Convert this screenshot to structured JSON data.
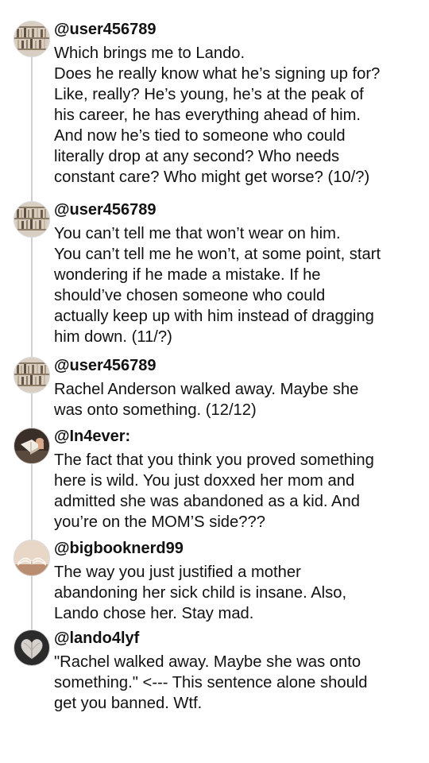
{
  "colors": {
    "text": "#111111",
    "thread_line": "#cfcfcf",
    "background": "#ffffff"
  },
  "posts": [
    {
      "handle": "@user456789",
      "avatar": "bookshelf-avatar",
      "lines": [
        "Which brings me to Lando.",
        "Does he really know what he’s signing up for?",
        "Like, really? He’s young, he’s at the peak of",
        "his career, he has everything ahead of him.",
        "And now he’s tied to someone who could",
        "literally drop at any second? Who needs",
        "constant care? Who might get worse? (10/?)"
      ]
    },
    {
      "handle": "@user456789",
      "avatar": "bookshelf-avatar",
      "lines": [
        "You can’t tell me that won’t wear on him.",
        "You can’t tell me he won’t, at some point, start",
        "wondering if he made a mistake. If he",
        "should’ve chosen someone who could",
        "actually keep up with him instead of dragging",
        "him down. (11/?)"
      ]
    },
    {
      "handle": "@user456789",
      "avatar": "bookshelf-avatar",
      "lines": [
        "Rachel Anderson walked away. Maybe she",
        "was onto something. (12/12)"
      ]
    },
    {
      "handle": "@In4ever:",
      "avatar": "reading-avatar",
      "lines": [
        "The fact that you think you proved something",
        "here is wild. You just doxxed her mom and",
        "admitted she was abandoned as a kid. And",
        "you’re on the MOM’S side???"
      ]
    },
    {
      "handle": "@bigbooknerd99",
      "avatar": "open-book-avatar",
      "lines": [
        "The way you just justified a mother",
        "abandoning her sick child is insane. Also,",
        "Lando chose her. Stay mad."
      ]
    },
    {
      "handle": "@lando4lyf",
      "avatar": "heart-book-avatar",
      "lines": [
        "\"Rachel walked away. Maybe she was onto",
        "something.\" <--- This sentence alone should",
        "get you banned. Wtf."
      ]
    }
  ]
}
